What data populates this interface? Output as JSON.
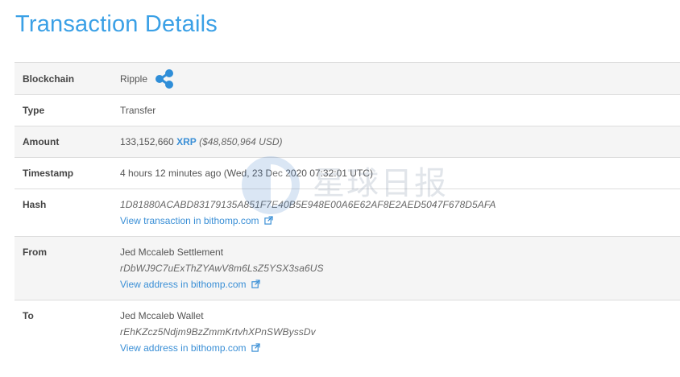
{
  "page": {
    "title": "Transaction Details"
  },
  "watermark": {
    "text": "星球日报"
  },
  "rows": {
    "blockchain": {
      "label": "Blockchain",
      "value": "Ripple",
      "icon": "ripple-logo-icon"
    },
    "type": {
      "label": "Type",
      "value": "Transfer"
    },
    "amount": {
      "label": "Amount",
      "value": "133,152,660",
      "currency": "XRP",
      "usd": "($48,850,964 USD)"
    },
    "timestamp": {
      "label": "Timestamp",
      "value": "4 hours 12 minutes ago (Wed, 23 Dec 2020 07:32:01 UTC)"
    },
    "hash": {
      "label": "Hash",
      "value": "1D81880ACABD83179135A851F7E40B5E948E00A6E62AF8E2AED5047F678D5AFA",
      "link": "View transaction in bithomp.com"
    },
    "from": {
      "label": "From",
      "name": "Jed Mccaleb Settlement",
      "address": "rDbWJ9C7uExThZYAwV8m6LsZ5YSX3sa6US",
      "link": "View address in bithomp.com"
    },
    "to": {
      "label": "To",
      "name": "Jed Mccaleb Wallet",
      "address": "rEhKZcz5Ndjm9BzZmmKrtvhXPnSWByssDv",
      "link": "View address in bithomp.com"
    }
  },
  "colors": {
    "accent": "#3a8fd6",
    "title": "#3aa0e6",
    "row_shade": "#f5f5f5",
    "border": "#dddddd"
  }
}
